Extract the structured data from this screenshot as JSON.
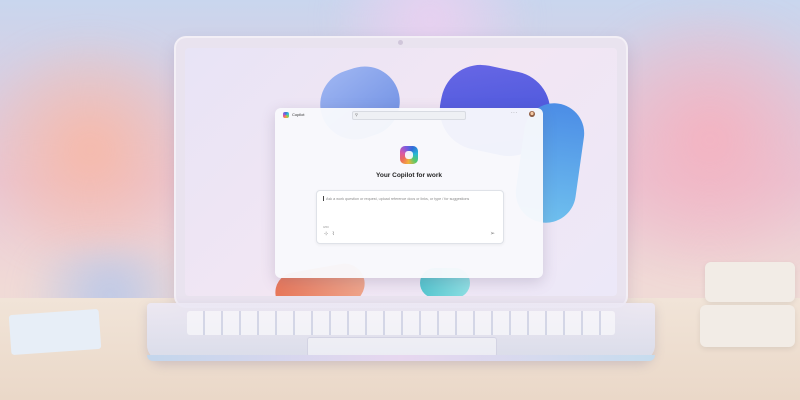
{
  "app": {
    "name": "Copilot"
  },
  "icons": {
    "search": "search-icon",
    "more": "more-icon",
    "avatar": "avatar",
    "add": "plus-icon",
    "attach": "paperclip-icon",
    "send": "send-icon"
  },
  "hero": {
    "title": "Your Copilot for work"
  },
  "prompt": {
    "placeholder": "Ask a work question or request, upload reference docs or links, or type / for suggestions",
    "char_count": "0/60"
  },
  "colors": {
    "accent_blue": "#3b4fd6",
    "window_bg": "#f8f9fc"
  }
}
